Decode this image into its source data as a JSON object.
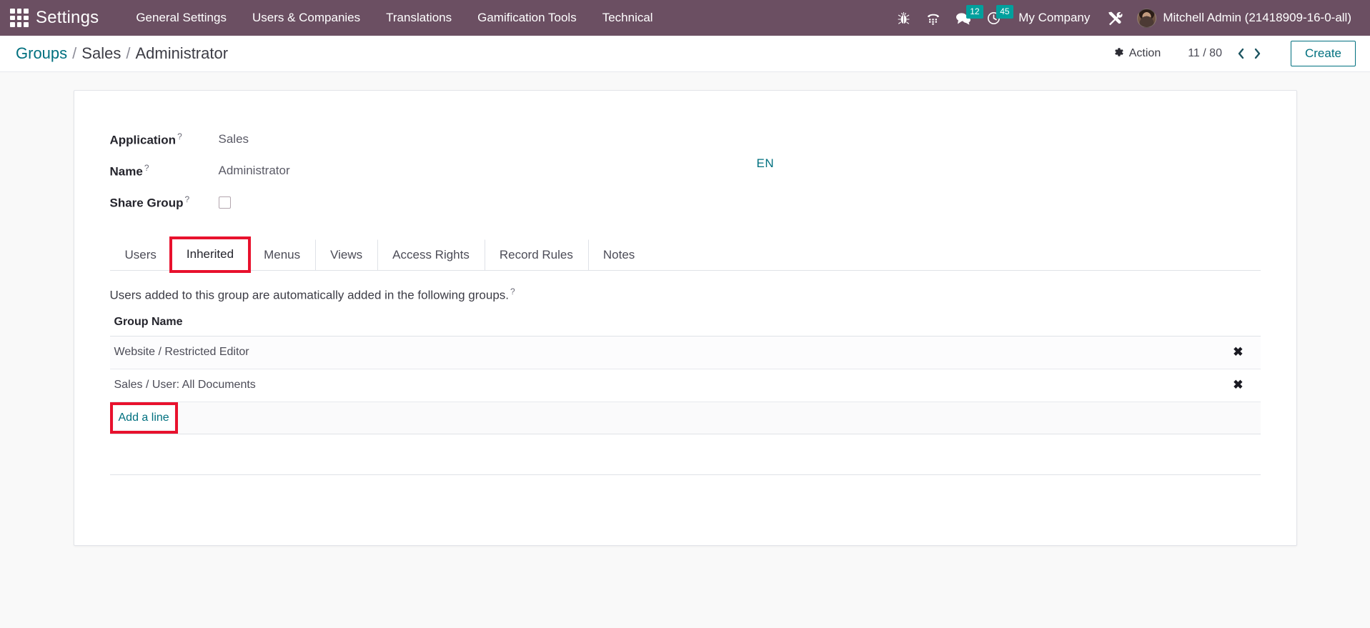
{
  "navbar": {
    "apps_icon": "apps-grid-icon",
    "brand": "Settings",
    "menu_items": [
      {
        "label": "General Settings"
      },
      {
        "label": "Users & Companies"
      },
      {
        "label": "Translations"
      },
      {
        "label": "Gamification Tools"
      },
      {
        "label": "Technical"
      }
    ],
    "icons": [
      {
        "name": "bug-icon",
        "badge": null
      },
      {
        "name": "dialpad-phone-icon",
        "badge": null
      },
      {
        "name": "messages-icon",
        "badge": "12"
      },
      {
        "name": "activities-clock-icon",
        "badge": "45"
      }
    ],
    "company": "My Company",
    "tools_icon": "wrench-screwdriver-icon",
    "user": "Mitchell Admin (21418909-16-0-all)",
    "bg_color": "#6b4f62",
    "badge_color": "#00a09d"
  },
  "control_panel": {
    "breadcrumb": [
      {
        "label": "Groups",
        "link": true
      },
      {
        "label": "Sales",
        "link": false
      },
      {
        "label": "Administrator",
        "link": false
      }
    ],
    "separator": "/",
    "action_label": "Action",
    "action_icon": "gear-icon",
    "pager_value": "11 / 80",
    "prev_icon": "chevron-left-icon",
    "next_icon": "chevron-right-icon",
    "create_label": "Create",
    "accent_color": "#00707f"
  },
  "form": {
    "fields": [
      {
        "label": "Application",
        "help": "?",
        "value": "Sales",
        "type": "text"
      },
      {
        "label": "Name",
        "help": "?",
        "value": "Administrator",
        "type": "text"
      },
      {
        "label": "Share Group",
        "help": "?",
        "value": "",
        "type": "checkbox",
        "checked": false
      }
    ],
    "translate_badge": "EN"
  },
  "notebook": {
    "tabs": [
      {
        "label": "Users",
        "active": false,
        "highlighted": false
      },
      {
        "label": "Inherited",
        "active": true,
        "highlighted": true
      },
      {
        "label": "Menus",
        "active": false,
        "highlighted": false
      },
      {
        "label": "Views",
        "active": false,
        "highlighted": false
      },
      {
        "label": "Access Rights",
        "active": false,
        "highlighted": false
      },
      {
        "label": "Record Rules",
        "active": false,
        "highlighted": false
      },
      {
        "label": "Notes",
        "active": false,
        "highlighted": false
      }
    ],
    "pane": {
      "help_text": "Users added to this group are automatically added in the following groups.",
      "help_mark": "?",
      "column_header": "Group Name",
      "rows": [
        {
          "name": "Website / Restricted Editor",
          "remove_icon": "✖"
        },
        {
          "name": "Sales / User: All Documents",
          "remove_icon": "✖"
        }
      ],
      "add_line_label": "Add a line",
      "add_line_highlighted": true
    }
  },
  "highlight_color": "#e8112d"
}
